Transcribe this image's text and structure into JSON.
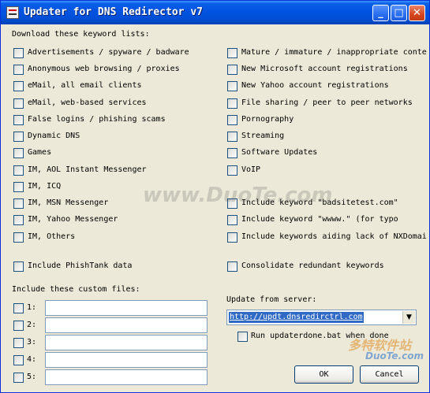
{
  "window": {
    "title": "Updater for DNS Redirector v7"
  },
  "titlebar_buttons": {
    "minimize": "_",
    "maximize": "□",
    "close": "✕"
  },
  "lists_heading": "Download these keyword lists:",
  "left_lists": [
    "Advertisements / spyware / badware",
    "Anonymous web browsing / proxies",
    "eMail, all email clients",
    "eMail, web-based services",
    "False logins / phishing scams",
    "Dynamic DNS",
    "Games",
    "IM, AOL Instant Messenger",
    "IM, ICQ",
    "IM, MSN Messenger",
    "IM, Yahoo Messenger",
    "IM, Others"
  ],
  "right_lists": [
    "Mature / immature / inappropriate conte",
    "New Microsoft account registrations",
    "New Yahoo account registrations",
    "File sharing / peer to peer networks",
    "Pornography",
    "Streaming",
    "Software Updates",
    "VoIP"
  ],
  "right_keywords": [
    "Include keyword \"badsitetest.com\"",
    "Include keyword \"wwww.\" (for typo",
    "Include keywords aiding lack of NXDomai"
  ],
  "phishtank_label": "Include PhishTank data",
  "consolidate_label": "Consolidate redundant keywords",
  "custom_files_heading": "Include these custom files:",
  "custom_files": [
    {
      "label": "1:",
      "value": ""
    },
    {
      "label": "2:",
      "value": ""
    },
    {
      "label": "3:",
      "value": ""
    },
    {
      "label": "4:",
      "value": ""
    },
    {
      "label": "5:",
      "value": ""
    }
  ],
  "server": {
    "label": "Update from server:",
    "selected": "http://updt.dnsredirctrl.com"
  },
  "run_updaterdone_label": "Run updaterdone.bat when done",
  "buttons": {
    "ok": "OK",
    "cancel": "Cancel"
  },
  "watermarks": [
    "www.DuoTe.com",
    "多特软件站",
    "DuoTe.com"
  ]
}
